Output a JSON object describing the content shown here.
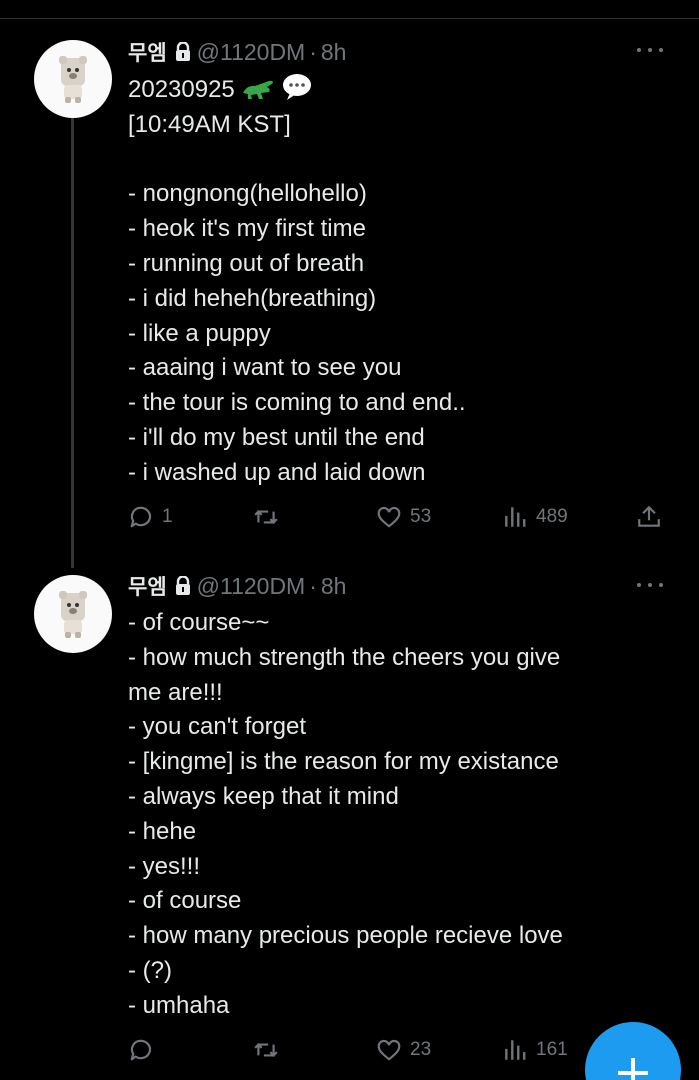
{
  "tweets": [
    {
      "display_name": "무엠",
      "handle": "@1120DM",
      "separator": "·",
      "time": "8h",
      "text_lines": [
        "20230925",
        "[10:49AM KST]",
        "",
        "- nongnong(hellohello)",
        "- heok it's my first time",
        "- running out of breath",
        "- i did heheh(breathing)",
        "- like a puppy",
        "- aaaing i want to see you",
        "- the tour is coming to and end..",
        "- i'll do my best until the end",
        "- i washed up and laid down"
      ],
      "stats": {
        "replies": "1",
        "retweets": "",
        "likes": "53",
        "views": "489"
      }
    },
    {
      "display_name": "무엠",
      "handle": "@1120DM",
      "separator": "·",
      "time": "8h",
      "text_lines": [
        "- of course~~",
        "- how much strength the cheers you give",
        "me are!!!",
        "- you can't forget",
        "- [kingme] is the reason for my existance",
        "- always keep that it mind",
        "- hehe",
        "- yes!!!",
        "- of course",
        "- how many precious people recieve love",
        "- (?)",
        "- umhaha"
      ],
      "stats": {
        "replies": "",
        "retweets": "",
        "likes": "23",
        "views": "161"
      }
    }
  ],
  "icons": {
    "lock": "lock-icon",
    "crocodile": "crocodile-emoji",
    "speech_bubble": "speech-bubble-emoji",
    "reply": "reply-icon",
    "retweet": "retweet-icon",
    "like": "heart-icon",
    "views": "views-icon",
    "share": "share-icon",
    "more": "more-icon",
    "compose": "compose-plus-icon"
  },
  "colors": {
    "background": "#000000",
    "text": "#e7e9ea",
    "muted": "#71767b",
    "accent": "#1d9bf0"
  }
}
